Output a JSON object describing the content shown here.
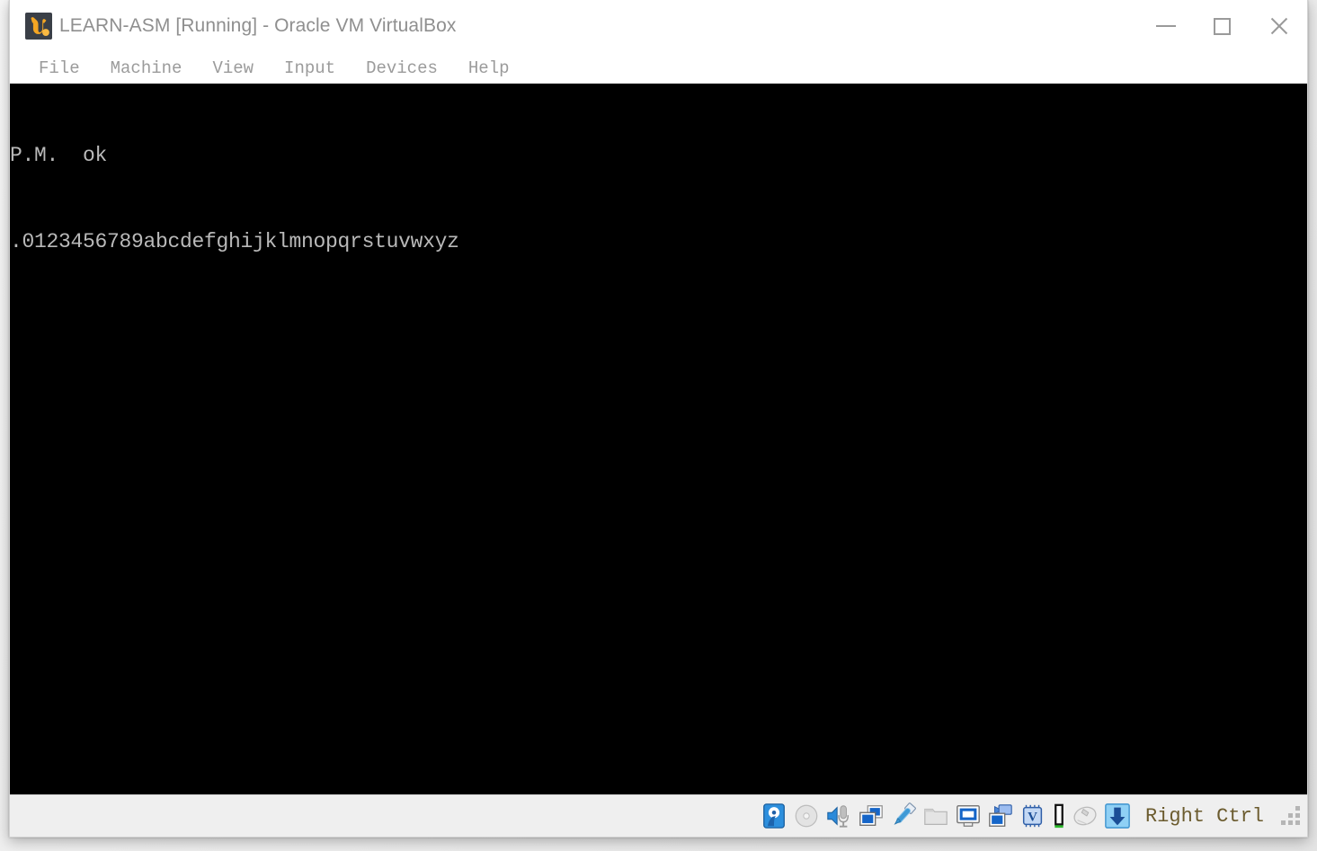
{
  "window": {
    "title": "LEARN-ASM [Running] - Oracle VM VirtualBox",
    "logo_icon": "virtualbox-logo-icon",
    "controls": {
      "minimize": "minimize-icon",
      "maximize": "maximize-icon",
      "close": "close-icon"
    }
  },
  "menu": {
    "items": [
      {
        "label": "File"
      },
      {
        "label": "Machine"
      },
      {
        "label": "View"
      },
      {
        "label": "Input"
      },
      {
        "label": "Devices"
      },
      {
        "label": "Help"
      }
    ]
  },
  "guest": {
    "lines": [
      "P.M.  ok",
      ".0123456789abcdefghijklmnopqrstuvwxyz"
    ],
    "background_color": "#000000",
    "text_color": "#b9b9b9"
  },
  "status_bar": {
    "icons": [
      {
        "name": "hard-disk-icon",
        "state": "active"
      },
      {
        "name": "optical-disk-icon",
        "state": "inactive"
      },
      {
        "name": "audio-icon",
        "state": "active"
      },
      {
        "name": "network-icon",
        "state": "active"
      },
      {
        "name": "usb-icon",
        "state": "active"
      },
      {
        "name": "shared-folders-icon",
        "state": "inactive"
      },
      {
        "name": "display-icon",
        "state": "active"
      },
      {
        "name": "recording-icon",
        "state": "active"
      },
      {
        "name": "virtualization-icon",
        "state": "active"
      },
      {
        "name": "keyboard-indicator-icon",
        "state": "active"
      },
      {
        "name": "mouse-integration-icon",
        "state": "inactive"
      },
      {
        "name": "host-key-icon",
        "state": "active"
      }
    ],
    "host_key_label": "Right Ctrl",
    "resize_grip_icon": "resize-grip-icon"
  },
  "colors": {
    "accent_blue": "#1565c8",
    "logo_orange": "#f5a623",
    "title_grey": "#8f8f8f",
    "menu_grey": "#9b9b9b",
    "status_bg": "#efefef"
  }
}
